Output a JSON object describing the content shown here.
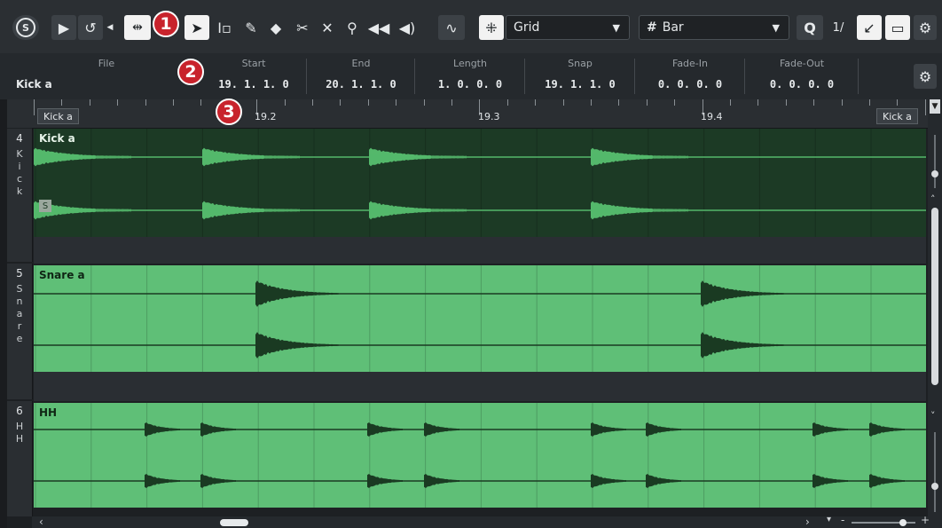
{
  "toolbar": {
    "solo_label": "S",
    "snap_type": "Grid",
    "grid_type": "Bar",
    "quantize_label": "Q",
    "quantize_value": "1/",
    "callouts": [
      "1",
      "2",
      "3"
    ]
  },
  "infoline": {
    "clip_name": "Kick a",
    "fields": [
      {
        "label": "File",
        "value": ""
      },
      {
        "label": "Start",
        "value": "19. 1. 1.   0"
      },
      {
        "label": "End",
        "value": "20. 1. 1.   0"
      },
      {
        "label": "Length",
        "value": "1. 0. 0.   0"
      },
      {
        "label": "Snap",
        "value": "19. 1. 1.   0"
      },
      {
        "label": "Fade-In",
        "value": "0. 0. 0.   0"
      },
      {
        "label": "Fade-Out",
        "value": "0. 0. 0.   0"
      }
    ]
  },
  "ruler": {
    "left_tag": "Kick a",
    "right_tag": "Kick a",
    "labels": [
      "19.2",
      "19.3",
      "19.4"
    ]
  },
  "lanes": [
    {
      "number": "4",
      "name": "Kick",
      "clip_name": "Kick a",
      "state_badge": "S",
      "bg": "#1c3a25",
      "wave": "#54b86b",
      "fg": "#e8f4ea"
    },
    {
      "number": "5",
      "name": "Snare",
      "clip_name": "Snare a",
      "bg": "#5fbf77",
      "wave": "#1a3a22",
      "fg": "#0f2514"
    },
    {
      "number": "6",
      "name": "HH",
      "clip_name": "HH",
      "bg": "#5fbf77",
      "wave": "#1a3a22",
      "fg": "#0f2514"
    }
  ],
  "colors": {
    "accent": "#c8232c",
    "clip_green": "#5fbf77",
    "selected_clip": "#1c3a25"
  }
}
